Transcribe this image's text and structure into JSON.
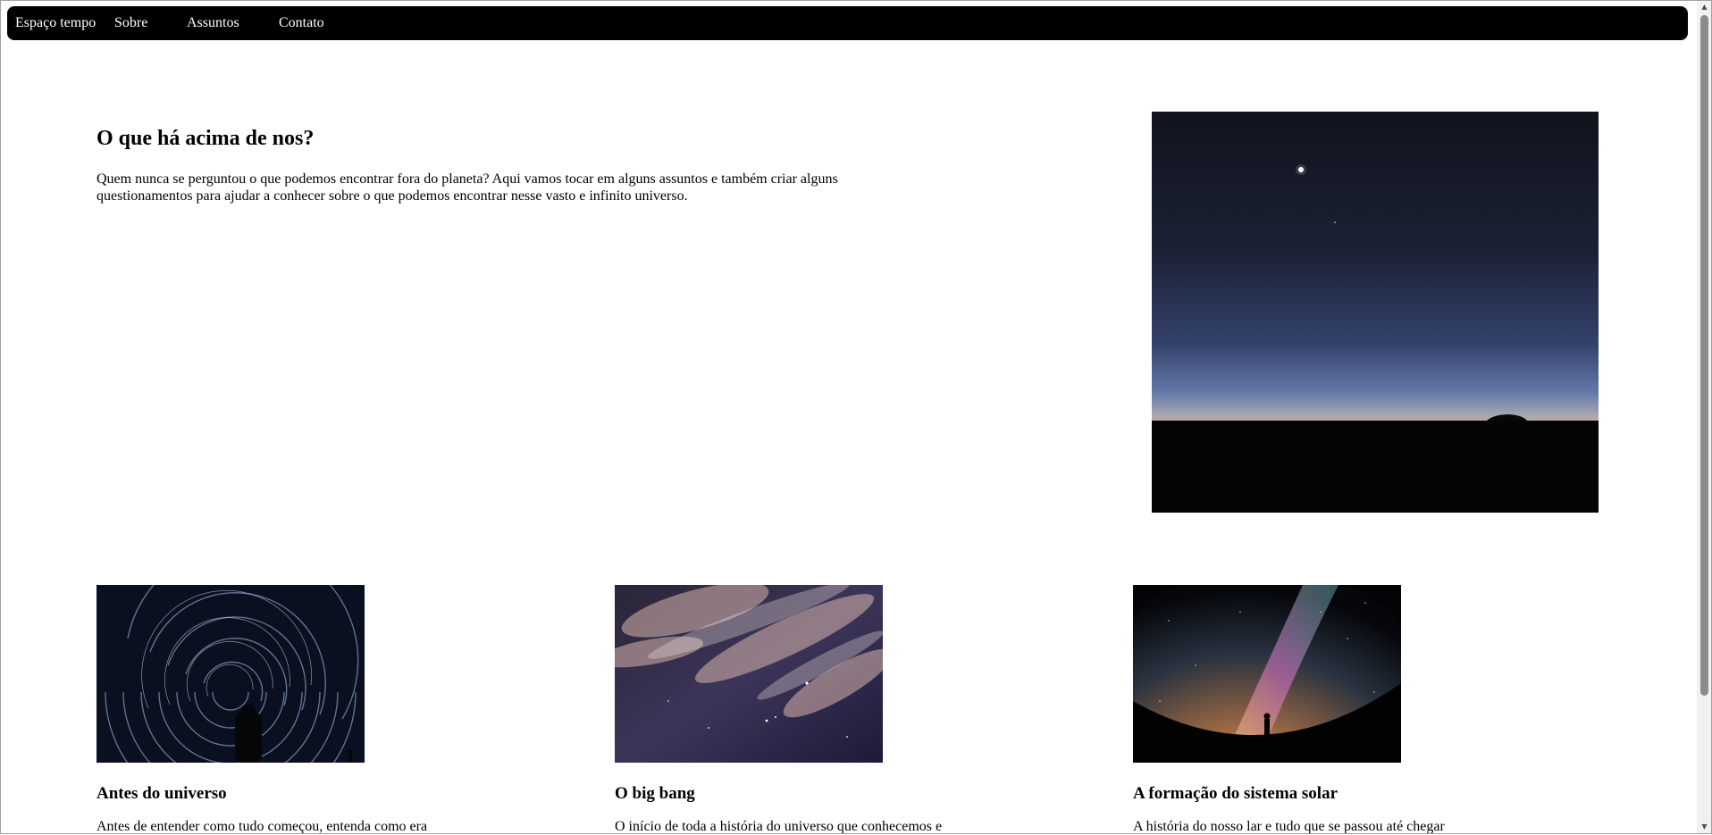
{
  "nav": {
    "brand": "Espaço tempo",
    "items": [
      "Sobre",
      "Assuntos",
      "Contato"
    ]
  },
  "hero": {
    "title": "O que há acima de nos?",
    "text": "Quem nunca se perguntou o que podemos encontrar fora do planeta? Aqui vamos tocar em alguns assuntos e também criar alguns questionamentos para ajudar a conhecer sobre o que podemos encontrar nesse vasto e infinito universo.",
    "image_icon": "night-sky-horizon-photo"
  },
  "cards": [
    {
      "title": "Antes do universo",
      "text": "Antes de entender como tudo começou, entenda como era",
      "image_icon": "star-trails-photo"
    },
    {
      "title": "O big bang",
      "text": "O início de toda a história do universo que conhecemos e",
      "image_icon": "cloudy-night-sky-photo"
    },
    {
      "title": "A formação do sistema solar",
      "text": "A história do nosso lar e tudo que se passou até chegar",
      "image_icon": "milky-way-photo"
    }
  ],
  "colors": {
    "navbar": "#000000",
    "nav_text": "#ffffff",
    "page_background": "#ffffff"
  }
}
